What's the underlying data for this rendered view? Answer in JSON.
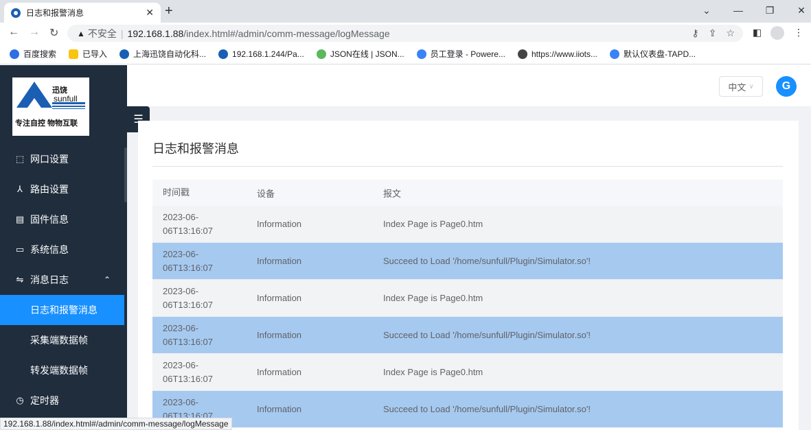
{
  "browser": {
    "tab_title": "日志和报警消息",
    "address": {
      "warning": "不安全",
      "host": "192.168.1.88",
      "path": "/index.html#/admin/comm-message/logMessage"
    },
    "bookmarks": [
      {
        "label": "百度搜索",
        "color": "#2f6fe4"
      },
      {
        "label": "已导入",
        "color": "#f9c513"
      },
      {
        "label": "上海迅饶自动化科...",
        "color": "#1a5fb4"
      },
      {
        "label": "192.168.1.244/Pa...",
        "color": "#1a5fb4"
      },
      {
        "label": "JSON在线 | JSON...",
        "color": "#5cb85c"
      },
      {
        "label": "员工登录 - Powere...",
        "color": "#3b82f6"
      },
      {
        "label": "https://www.iiots...",
        "color": "#444444"
      },
      {
        "label": "默认仪表盘-TAPD...",
        "color": "#3b82f6"
      }
    ],
    "status_url": "192.168.1.88/index.html#/admin/comm-message/logMessage"
  },
  "sidebar": {
    "logo": {
      "cn": "迅饶",
      "en": "sunfull",
      "slogan": "专注自控 物物互联"
    },
    "items": [
      {
        "label": "网口设置",
        "icon": "network-icon"
      },
      {
        "label": "路由设置",
        "icon": "route-icon"
      },
      {
        "label": "固件信息",
        "icon": "firmware-icon"
      },
      {
        "label": "系统信息",
        "icon": "monitor-icon"
      },
      {
        "label": "消息日志",
        "icon": "log-icon"
      }
    ],
    "submenu": [
      {
        "label": "日志和报警消息",
        "active": true
      },
      {
        "label": "采集端数据帧",
        "active": false
      },
      {
        "label": "转发端数据帧",
        "active": false
      }
    ],
    "after": {
      "label": "定时器",
      "icon": "clock-icon"
    }
  },
  "topbar": {
    "language": "中文",
    "user_initial": "G"
  },
  "main": {
    "title": "日志和报警消息",
    "columns": [
      "时间戳",
      "设备",
      "报文"
    ],
    "rows": [
      {
        "time": "2023-06-06T13:16:07",
        "time_a": "2023-06-",
        "time_b": "06T13:16:07",
        "device": "Information",
        "message": "Index Page is Page0.htm"
      },
      {
        "time": "2023-06-06T13:16:07",
        "time_a": "2023-06-",
        "time_b": "06T13:16:07",
        "device": "Information",
        "message": "Succeed to Load '/home/sunfull/Plugin/Simulator.so'!"
      },
      {
        "time": "2023-06-06T13:16:07",
        "time_a": "2023-06-",
        "time_b": "06T13:16:07",
        "device": "Information",
        "message": "Index Page is Page0.htm"
      },
      {
        "time": "2023-06-06T13:16:07",
        "time_a": "2023-06-",
        "time_b": "06T13:16:07",
        "device": "Information",
        "message": "Succeed to Load '/home/sunfull/Plugin/Simulator.so'!"
      },
      {
        "time": "2023-06-06T13:16:07",
        "time_a": "2023-06-",
        "time_b": "06T13:16:07",
        "device": "Information",
        "message": "Index Page is Page0.htm"
      },
      {
        "time": "2023-06-06T13:16:07",
        "time_a": "2023-06-",
        "time_b": "06T13:16:07",
        "device": "Information",
        "message": "Succeed to Load '/home/sunfull/Plugin/Simulator.so'!"
      }
    ]
  },
  "colors": {
    "sidebar": "#1f2d3d",
    "accent": "#1890ff",
    "highlight_row": "#a6c9f0"
  }
}
